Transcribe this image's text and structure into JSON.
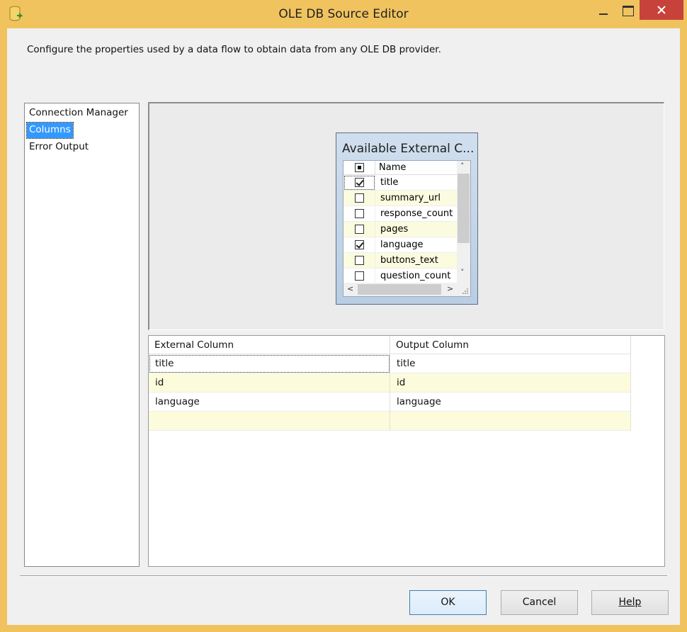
{
  "window": {
    "title": "OLE DB Source Editor"
  },
  "description": "Configure the properties used by a data flow to obtain data from any OLE DB provider.",
  "nav": {
    "items": [
      {
        "label": "Connection Manager",
        "selected": false
      },
      {
        "label": "Columns",
        "selected": true
      },
      {
        "label": "Error Output",
        "selected": false
      }
    ]
  },
  "available_columns": {
    "title": "Available External C...",
    "header_name": "Name",
    "rows": [
      {
        "name": "title",
        "checked": true
      },
      {
        "name": "summary_url",
        "checked": false
      },
      {
        "name": "response_count",
        "checked": false
      },
      {
        "name": "pages",
        "checked": false
      },
      {
        "name": "language",
        "checked": true
      },
      {
        "name": "buttons_text",
        "checked": false
      },
      {
        "name": "question_count",
        "checked": false
      }
    ]
  },
  "mapping": {
    "headers": [
      "External Column",
      "Output Column"
    ],
    "rows": [
      [
        "title",
        "title"
      ],
      [
        "id",
        "id"
      ],
      [
        "language",
        "language"
      ],
      [
        "",
        ""
      ]
    ]
  },
  "buttons": {
    "ok": "OK",
    "cancel": "Cancel",
    "help": "Help"
  },
  "colors": {
    "window_frame": "#f0c35f",
    "close_button": "#c7423a",
    "selection": "#3399ff",
    "alt_row": "#fcfcdc"
  }
}
